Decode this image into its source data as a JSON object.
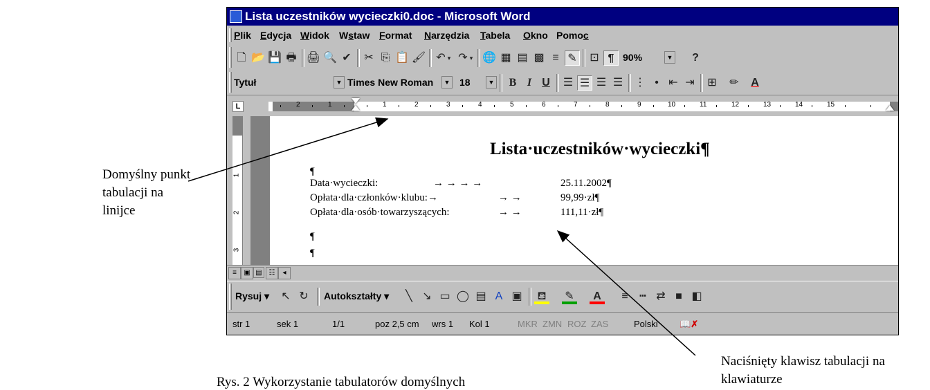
{
  "window": {
    "title": "Lista uczestników wycieczki0.doc - Microsoft Word"
  },
  "menu": [
    "Plik",
    "Edycja",
    "Widok",
    "Wstaw",
    "Format",
    "Narzędzia",
    "Tabela",
    "Okno",
    "Pomoc"
  ],
  "toolbar_standard": {
    "zoom": "90%",
    "icons": [
      "new-document-icon",
      "open-folder-icon",
      "save-disk-icon",
      "print-preview-page-icon",
      "printer-icon",
      "print-preview-icon",
      "spelling-check-icon",
      "cut-icon",
      "copy-icon",
      "paste-icon",
      "format-painter-icon",
      "undo-icon",
      "redo-icon",
      "hyperlink-globe-icon",
      "tables-borders-icon",
      "insert-table-icon",
      "insert-excel-icon",
      "columns-icon",
      "drawing-icon",
      "document-map-icon",
      "show-formatting-icon",
      "help-icon"
    ]
  },
  "toolbar_formatting": {
    "style": "Tytuł",
    "font": "Times New Roman",
    "size": "18",
    "bold": "B",
    "italic": "I",
    "underline": "U"
  },
  "ruler": {
    "numbers_left": [
      "2",
      "1"
    ],
    "numbers_right": [
      "1",
      "2",
      "3",
      "4",
      "5",
      "6",
      "7",
      "8",
      "9",
      "10",
      "11",
      "12",
      "13",
      "14",
      "15"
    ],
    "corner": "L"
  },
  "vruler": {
    "numbers": [
      "1",
      "2",
      "3"
    ]
  },
  "document": {
    "title": "Lista·uczestników·wycieczki¶",
    "empty_para": "¶",
    "lines": [
      {
        "label": "Data·wycieczki:",
        "tabs": "→      →      →      →",
        "value": "25.11.2002¶"
      },
      {
        "label": "Opłata·dla·członków·klubu:→",
        "tabs": "→      →",
        "value": "99,99·zł¶"
      },
      {
        "label": "Opłata·dla·osób·towarzyszących:",
        "tabs": "→      →",
        "value": "111,11·zł¶"
      }
    ],
    "trailing_paras": [
      "¶",
      "¶"
    ]
  },
  "drawing_toolbar": {
    "draw": "Rysuj",
    "autoshapes": "Autokształty"
  },
  "statusbar": {
    "page": "str 1",
    "section": "sek 1",
    "pages": "1/1",
    "position": "poz 2,5 cm",
    "line": "wrs 1",
    "column": "Kol 1",
    "modes": [
      "MKR",
      "ZMN",
      "ROZ",
      "ZAS"
    ],
    "language": "Polski"
  },
  "annotations": {
    "left": "Domyślny punkt tabulacji na linijce",
    "right": "Naciśnięty klawisz tabulacji na klawiaturze",
    "caption": "Rys. 2 Wykorzystanie tabulatorów domyślnych"
  }
}
